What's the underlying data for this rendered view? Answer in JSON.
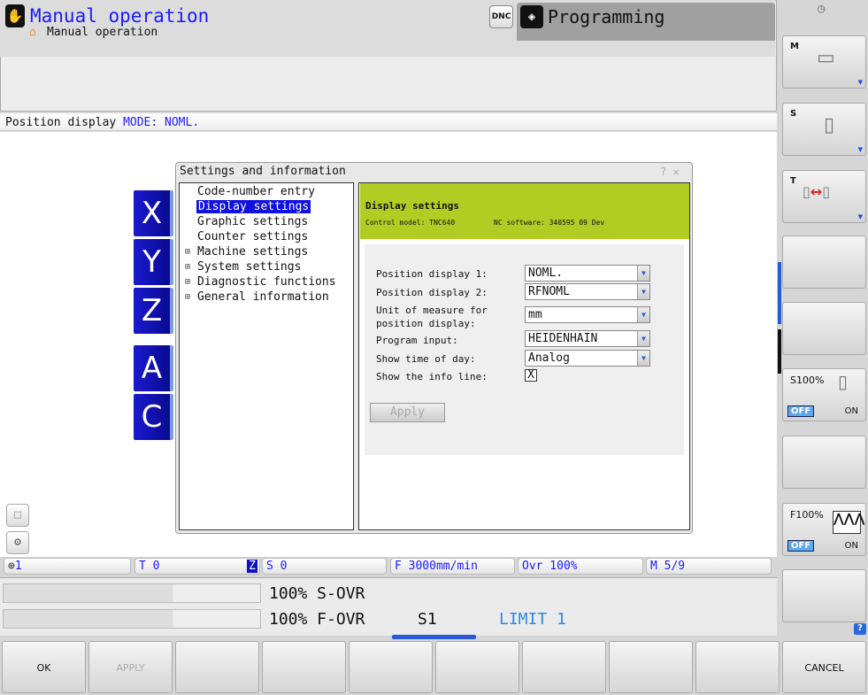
{
  "header": {
    "mode_title": "Manual operation",
    "breadcrumb": "Manual operation",
    "dnc_label": "DNC",
    "programming_tab": "Programming"
  },
  "info_line": {
    "label": "Position display",
    "mode": "MODE: NOML."
  },
  "axes": [
    "X",
    "Y",
    "Z",
    "A",
    "C"
  ],
  "dialog": {
    "title": "Settings and information",
    "controls": "? ✕",
    "tree": [
      {
        "label": "Code-number entry",
        "expandable": false
      },
      {
        "label": "Display settings",
        "expandable": false,
        "selected": true
      },
      {
        "label": "Graphic settings",
        "expandable": false
      },
      {
        "label": "Counter settings",
        "expandable": false
      },
      {
        "label": "Machine settings",
        "expandable": true
      },
      {
        "label": "System settings",
        "expandable": true
      },
      {
        "label": "Diagnostic functions",
        "expandable": true
      },
      {
        "label": "General information",
        "expandable": true
      }
    ],
    "panel_title": "Display settings",
    "control_model": "Control model: TNC640",
    "nc_software": "NC software: 340595 09 Dev",
    "fields": [
      {
        "label": "Position display 1:",
        "value": "NOML."
      },
      {
        "label": "Position display 2:",
        "value": "RFNOML"
      },
      {
        "label": "Unit of measure for position display:",
        "value": "mm"
      },
      {
        "label": "Program input:",
        "value": "HEIDENHAIN"
      },
      {
        "label": "Show time of day:",
        "value": "Analog"
      }
    ],
    "info_line_label": "Show the info line:",
    "info_line_checked": true,
    "check_mark": "X",
    "apply_label": "Apply",
    "header_color": "#b1cc22"
  },
  "status_bar": {
    "preset": "1",
    "tool": "T 0",
    "tool_axis": "Z",
    "spindle": "S 0",
    "feed": "F 3000mm/min",
    "override": "Ovr 100%",
    "m_functions": "M 5/9"
  },
  "overrides": {
    "s_ovr": "100% S-OVR",
    "f_ovr": "100% F-OVR",
    "s1": "S1",
    "limit": "LIMIT 1",
    "s_ovr_percent": 100,
    "f_ovr_percent": 100
  },
  "softkeys_bottom": [
    "OK",
    "APPLY",
    "",
    "",
    "",
    "",
    "",
    "",
    "",
    "CANCEL"
  ],
  "softkeys_right": {
    "m": "M",
    "s": "S",
    "t": "T",
    "s100": "S100%",
    "f100": "F100%",
    "off": "OFF",
    "on": "ON"
  },
  "colors": {
    "accent_blue": "#1a1aff",
    "limit_blue": "#2a8ae8"
  }
}
